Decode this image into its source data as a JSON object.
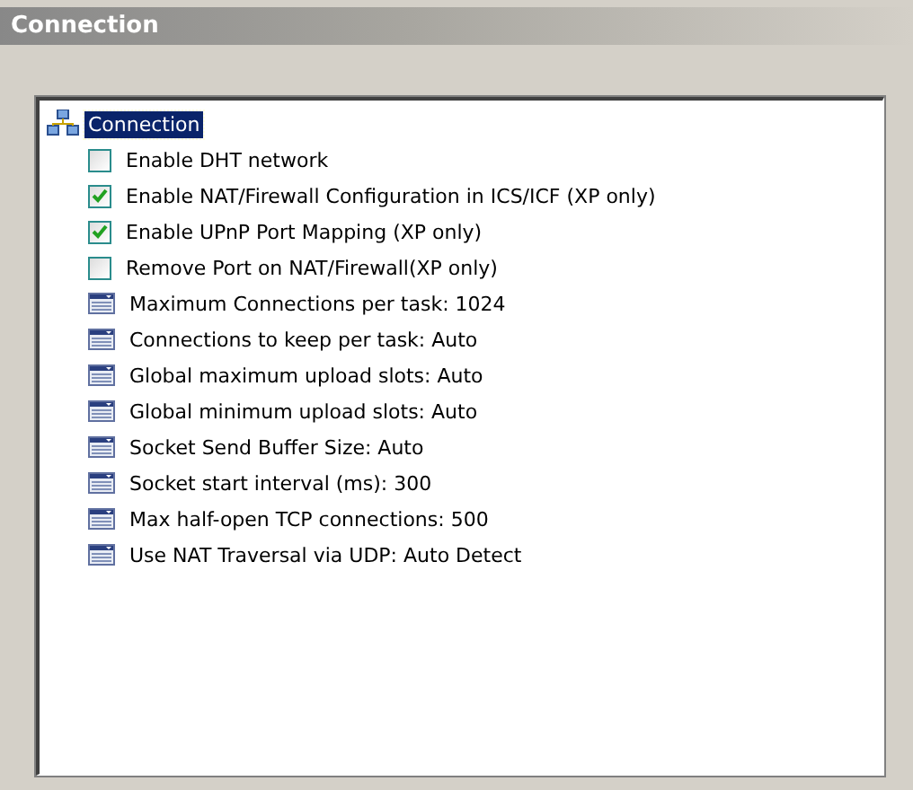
{
  "header": {
    "title": "Connection"
  },
  "tree": {
    "root": {
      "label": "Connection",
      "selected": true,
      "children": [
        {
          "kind": "checkbox",
          "label": "Enable DHT network",
          "checked": false
        },
        {
          "kind": "checkbox",
          "label": "Enable NAT/Firewall Configuration in ICS/ICF (XP only)",
          "checked": true
        },
        {
          "kind": "checkbox",
          "label": "Enable UPnP Port Mapping (XP only)",
          "checked": true
        },
        {
          "kind": "checkbox",
          "label": "Remove Port on NAT/Firewall(XP only)",
          "checked": false
        },
        {
          "kind": "setting",
          "label": "Maximum Connections per task: 1024"
        },
        {
          "kind": "setting",
          "label": "Connections to keep per task: Auto"
        },
        {
          "kind": "setting",
          "label": "Global maximum upload slots: Auto"
        },
        {
          "kind": "setting",
          "label": "Global minimum upload slots: Auto"
        },
        {
          "kind": "setting",
          "label": "Socket Send Buffer Size: Auto"
        },
        {
          "kind": "setting",
          "label": "Socket start interval (ms): 300"
        },
        {
          "kind": "setting",
          "label": "Max half-open TCP connections: 500"
        },
        {
          "kind": "setting",
          "label": "Use NAT Traversal via UDP: Auto Detect"
        }
      ]
    }
  }
}
